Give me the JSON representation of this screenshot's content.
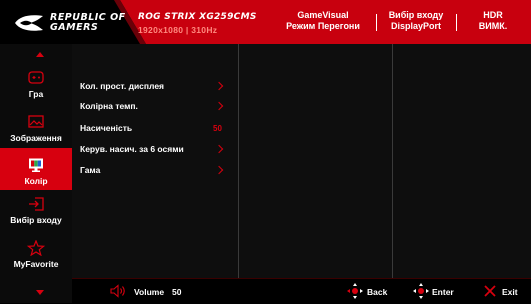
{
  "header": {
    "brand_line1": "REPUBLIC OF",
    "brand_line2": "GAMERS",
    "model": "ROG STRIX XG259CMS",
    "resolution": "1920x1080 | 310Hz",
    "cells": [
      {
        "line1": "GameVisual",
        "line2": "Режим Перегони"
      },
      {
        "line1": "Вибір входу",
        "line2": "DisplayPort"
      },
      {
        "line1": "HDR",
        "line2": "ВИМК."
      }
    ],
    "accent": "#d7000f"
  },
  "sidebar": {
    "items": [
      {
        "label": "Гра",
        "icon": "gamepad-icon"
      },
      {
        "label": "Зображення",
        "icon": "image-icon"
      },
      {
        "label": "Колір",
        "icon": "color-monitor-icon",
        "active": true
      },
      {
        "label": "Вибір входу",
        "icon": "input-select-icon"
      },
      {
        "label": "MyFavorite",
        "icon": "star-icon"
      }
    ]
  },
  "menu": {
    "items": [
      {
        "label": "Кол. прост. дисплея",
        "has_submenu": true
      },
      {
        "label": "Колірна темп.",
        "has_submenu": true
      },
      {
        "label": "Насиченість",
        "value": "50"
      },
      {
        "label": "Керув. насич. за 6 осями",
        "has_submenu": true
      },
      {
        "label": "Гама",
        "has_submenu": true
      }
    ]
  },
  "footer": {
    "volume_label": "Volume",
    "volume_value": "50",
    "back_label": "Back",
    "enter_label": "Enter",
    "exit_label": "Exit"
  }
}
